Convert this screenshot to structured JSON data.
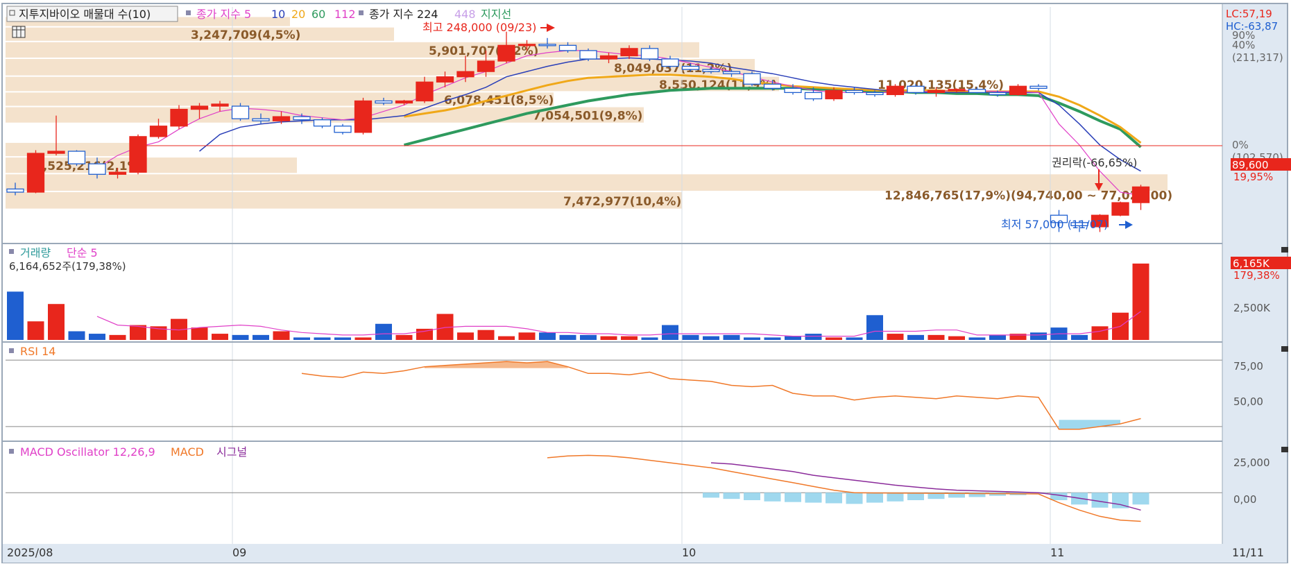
{
  "legend": {
    "stock_name": "지투지바이오 매물대 수(10)",
    "ma_label": "종가 지수 5",
    "ma_periods": [
      "10",
      "20",
      "60",
      "112"
    ],
    "ma_long_label": "종가 지수 224",
    "ma_long2": "448",
    "support_label": "지지선"
  },
  "right_labels": {
    "lc": "LC:57,19",
    "hc": "HC:-63,87",
    "pct_90": "90%",
    "pct_40": "40%",
    "pct_40_value": "(211,317)",
    "pct_0": "0%",
    "pct_0_value": "(102,570)",
    "price_box": "89,600",
    "price_change": "19,95%"
  },
  "volume_panel": {
    "title": "거래량",
    "ma_label": "단순 5",
    "current_volume": "6,164,652주(179,38%)",
    "box": "6,165K",
    "box_change": "179,38%",
    "axis_label": "2,500K"
  },
  "rsi_panel": {
    "title": "RSI 14",
    "ticks": [
      "75,00",
      "50,00"
    ]
  },
  "macd_panel": {
    "title": "MACD Oscillator 12,26,9",
    "macd_label": "MACD",
    "signal_label": "시그널",
    "ticks": [
      "25,000",
      "0,00"
    ]
  },
  "x_axis": {
    "labels": [
      "2025/08",
      "09",
      "10",
      "11"
    ],
    "right_label": "11/11"
  },
  "annotations": {
    "high": "최고 248,000 (09/23)",
    "low": "최저 57,000 (11/07)",
    "rights_drop": "권리락(-66,65%)",
    "price_range": "12,846,765(17,9%)(94,740,00 ~ 77,020,00)"
  },
  "volume_profile_labels": [
    "3,247,709(4,5%)",
    "5,901,707(8,2%)",
    "8,049,037(11,2%)",
    "11,020,135(15,4%)",
    "8,550,124(11,9%)",
    "6,078,451(8,5%)",
    "7,054,501(9,8%)",
    "1,525,216(2,1%)",
    "7,472,977(10,4%)"
  ],
  "colors": {
    "up": "#e8261c",
    "down": "#1f5fd0",
    "ma5": "#e040c8",
    "ma10": "#2a3fb8",
    "ma20": "#f0a818",
    "ma60": "#2e9a5e",
    "rsi": "#f07828",
    "macd": "#f07828",
    "signal": "#8a2a9a",
    "osc": "#9fd8ee",
    "profile": "#f4e2cc",
    "profile_text": "#8a5a2a"
  },
  "chart_data": {
    "type": "candlestick",
    "series": [
      {
        "name": "price",
        "values": [
          [
            98000,
            104000,
            92000,
            95000
          ],
          [
            95000,
            135000,
            94000,
            132000
          ],
          [
            132000,
            168000,
            130000,
            134000
          ],
          [
            134000,
            135000,
            120000,
            122000
          ],
          [
            122000,
            128000,
            108000,
            112000
          ],
          [
            112000,
            118000,
            108000,
            114000
          ],
          [
            114000,
            150000,
            112000,
            148000
          ],
          [
            148000,
            165000,
            146000,
            158000
          ],
          [
            158000,
            178000,
            155000,
            174000
          ],
          [
            174000,
            180000,
            165000,
            177000
          ],
          [
            177000,
            182000,
            172000,
            179000
          ],
          [
            177000,
            180000,
            163000,
            165000
          ],
          [
            165000,
            170000,
            160000,
            163000
          ],
          [
            163000,
            172000,
            160000,
            167000
          ],
          [
            167000,
            170000,
            160000,
            164000
          ],
          [
            164000,
            166000,
            156000,
            158000
          ],
          [
            158000,
            160000,
            150000,
            152000
          ],
          [
            152000,
            185000,
            150000,
            182000
          ],
          [
            182000,
            185000,
            178000,
            180000
          ],
          [
            180000,
            183000,
            178000,
            182000
          ],
          [
            182000,
            205000,
            180000,
            200000
          ],
          [
            200000,
            210000,
            195000,
            205000
          ],
          [
            205000,
            225000,
            200000,
            210000
          ],
          [
            210000,
            230000,
            205000,
            220000
          ],
          [
            220000,
            248000,
            218000,
            235000
          ],
          [
            235000,
            240000,
            230000,
            236000
          ],
          [
            236000,
            242000,
            232000,
            235000
          ],
          [
            235000,
            238000,
            228000,
            230000
          ],
          [
            230000,
            232000,
            220000,
            222000
          ],
          [
            222000,
            228000,
            218000,
            225000
          ],
          [
            225000,
            235000,
            222000,
            232000
          ],
          [
            232000,
            235000,
            220000,
            222000
          ],
          [
            222000,
            225000,
            213000,
            215000
          ],
          [
            215000,
            218000,
            210000,
            212000
          ],
          [
            212000,
            215000,
            208000,
            210000
          ],
          [
            210000,
            212000,
            205000,
            208000
          ],
          [
            208000,
            210000,
            196000,
            198000
          ],
          [
            198000,
            202000,
            192000,
            194000
          ],
          [
            194000,
            198000,
            188000,
            190000
          ],
          [
            190000,
            195000,
            182000,
            184000
          ],
          [
            184000,
            195000,
            182000,
            192000
          ],
          [
            192000,
            195000,
            188000,
            190000
          ],
          [
            190000,
            192000,
            186000,
            188000
          ],
          [
            188000,
            198000,
            186000,
            196000
          ],
          [
            196000,
            198000,
            188000,
            190000
          ],
          [
            190000,
            195000,
            186000,
            192000
          ],
          [
            192000,
            194000,
            190000,
            193000
          ],
          [
            193000,
            195000,
            189000,
            190000
          ],
          [
            190000,
            192000,
            186000,
            188000
          ],
          [
            188000,
            198000,
            187000,
            196000
          ],
          [
            196000,
            198000,
            192000,
            194000
          ],
          [
            73000,
            78000,
            57000,
            66000
          ],
          [
            66000,
            68000,
            57000,
            63000
          ],
          [
            62000,
            74000,
            57000,
            73000
          ],
          [
            73000,
            86000,
            72000,
            85000
          ],
          [
            85000,
            102000,
            78000,
            100000
          ]
        ]
      },
      {
        "name": "ma5",
        "values": [
          null,
          null,
          null,
          null,
          118000,
          130000,
          138000,
          143000,
          155000,
          165000,
          172000,
          175000,
          174000,
          172000,
          168000,
          166000,
          164000,
          166000,
          172000,
          178000,
          188000,
          196000,
          204000,
          210000,
          218000,
          225000,
          228000,
          230000,
          230000,
          228000,
          226000,
          225000,
          222000,
          218000,
          214000,
          210000,
          205000,
          200000,
          196000,
          192000,
          190000,
          190000,
          190000,
          190000,
          191000,
          191000,
          192000,
          192000,
          191000,
          191000,
          190000,
          160000,
          140000,
          115000,
          95000,
          92000
        ]
      },
      {
        "name": "ma10",
        "values": [
          null,
          null,
          null,
          null,
          null,
          null,
          null,
          null,
          null,
          134000,
          150000,
          157000,
          160000,
          162000,
          163000,
          164000,
          164000,
          164000,
          166000,
          168000,
          175000,
          182000,
          188000,
          195000,
          205000,
          210000,
          215000,
          219000,
          222000,
          222000,
          223000,
          222000,
          221000,
          220000,
          218000,
          214000,
          211000,
          208000,
          204000,
          200000,
          197000,
          195000,
          193000,
          191000,
          190000,
          190000,
          190000,
          190000,
          190000,
          190000,
          190000,
          178000,
          160000,
          140000,
          126000,
          115000
        ]
      },
      {
        "name": "ma20",
        "values": [
          null,
          null,
          null,
          null,
          null,
          null,
          null,
          null,
          null,
          null,
          null,
          null,
          null,
          null,
          null,
          null,
          null,
          null,
          null,
          167000,
          170000,
          173000,
          177000,
          182000,
          187000,
          192000,
          197000,
          201000,
          204000,
          205000,
          206000,
          207000,
          207000,
          206000,
          205000,
          203000,
          200000,
          198000,
          196000,
          195000,
          194000,
          193000,
          192000,
          192000,
          192000,
          192000,
          191000,
          191000,
          191000,
          191000,
          191000,
          186000,
          178000,
          168000,
          157000,
          142000
        ]
      },
      {
        "name": "ma60",
        "values": [
          null,
          null,
          null,
          null,
          null,
          null,
          null,
          null,
          null,
          null,
          null,
          null,
          null,
          null,
          null,
          null,
          null,
          null,
          null,
          140000,
          145000,
          150000,
          155000,
          160000,
          165000,
          170000,
          174000,
          178000,
          182000,
          185000,
          188000,
          190000,
          192000,
          193000,
          194000,
          194000,
          194000,
          194000,
          194000,
          193000,
          193000,
          192000,
          191000,
          191000,
          190000,
          190000,
          189000,
          189000,
          188000,
          188000,
          187000,
          180000,
          172000,
          163000,
          155000,
          138000
        ]
      },
      {
        "name": "volume",
        "values": [
          3900,
          1500,
          2900,
          700,
          500,
          400,
          1200,
          1100,
          1700,
          1000,
          500,
          400,
          400,
          700,
          200,
          200,
          200,
          200,
          1300,
          400,
          900,
          2100,
          600,
          800,
          300,
          600,
          600,
          400,
          400,
          300,
          300,
          200,
          1200,
          400,
          300,
          400,
          200,
          200,
          300,
          500,
          200,
          200,
          2000,
          500,
          400,
          400,
          300,
          200,
          400,
          500,
          600,
          1000,
          400,
          1100,
          2200,
          6165
        ]
      },
      {
        "name": "volume_ma5",
        "values": [
          null,
          null,
          null,
          null,
          1900,
          1200,
          1100,
          900,
          800,
          1000,
          1100,
          1200,
          1100,
          800,
          600,
          500,
          400,
          400,
          500,
          500,
          700,
          1000,
          1100,
          1100,
          1100,
          900,
          600,
          600,
          500,
          500,
          400,
          400,
          500,
          500,
          500,
          500,
          500,
          400,
          300,
          300,
          300,
          300,
          700,
          700,
          700,
          800,
          800,
          400,
          400,
          400,
          400,
          500,
          500,
          700,
          1100,
          2300
        ]
      },
      {
        "name": "rsi",
        "values": [
          null,
          null,
          null,
          null,
          null,
          null,
          null,
          null,
          null,
          null,
          null,
          null,
          null,
          null,
          65,
          63,
          62,
          66,
          65,
          67,
          70,
          71,
          72,
          73,
          74,
          73,
          74,
          70,
          65,
          65,
          64,
          66,
          61,
          60,
          59,
          56,
          55,
          56,
          50,
          48,
          48,
          45,
          47,
          48,
          47,
          46,
          48,
          47,
          46,
          48,
          47,
          23,
          23,
          25,
          27,
          31
        ]
      },
      {
        "name": "macd",
        "values": [
          null,
          null,
          null,
          null,
          null,
          null,
          null,
          null,
          null,
          null,
          null,
          null,
          null,
          null,
          null,
          null,
          null,
          null,
          null,
          null,
          null,
          null,
          null,
          null,
          null,
          null,
          28000,
          29500,
          30000,
          29500,
          28000,
          26000,
          24000,
          22000,
          20000,
          17000,
          14000,
          11000,
          8000,
          5000,
          2000,
          0,
          -200,
          -300,
          -400,
          -500,
          -600,
          -700,
          -800,
          -900,
          -1000,
          -8000,
          -14000,
          -19000,
          -22000,
          -23000
        ]
      },
      {
        "name": "signal",
        "values": [
          null,
          null,
          null,
          null,
          null,
          null,
          null,
          null,
          null,
          null,
          null,
          null,
          null,
          null,
          null,
          null,
          null,
          null,
          null,
          null,
          null,
          null,
          null,
          null,
          null,
          null,
          null,
          null,
          null,
          null,
          null,
          null,
          null,
          null,
          24000,
          23000,
          21000,
          19000,
          17000,
          14000,
          12000,
          10000,
          8000,
          6000,
          4500,
          3000,
          2000,
          1500,
          1000,
          500,
          0,
          -2000,
          -4500,
          -7000,
          -9500,
          -14000
        ]
      },
      {
        "name": "macd_osc",
        "values": [
          null,
          null,
          null,
          null,
          null,
          null,
          null,
          null,
          null,
          null,
          null,
          null,
          null,
          null,
          null,
          null,
          null,
          null,
          null,
          null,
          null,
          null,
          null,
          null,
          null,
          null,
          null,
          null,
          null,
          null,
          null,
          null,
          null,
          null,
          -4000,
          -5000,
          -6000,
          -7000,
          -7500,
          -8000,
          -8500,
          -9000,
          -8000,
          -7000,
          -6000,
          -5000,
          -4000,
          -3500,
          -2500,
          -2000,
          -1000,
          -6000,
          -9500,
          -12000,
          -12500,
          -9500
        ]
      }
    ],
    "x_labels": [
      "2025/08",
      "09",
      "10",
      "11",
      "11/11"
    ],
    "price_ylim": [
      50000,
      265000
    ],
    "volume_ylim": [
      0,
      7000
    ],
    "rsi_ylim": [
      15,
      85
    ],
    "macd_ylim": [
      -40000,
      38000
    ]
  }
}
